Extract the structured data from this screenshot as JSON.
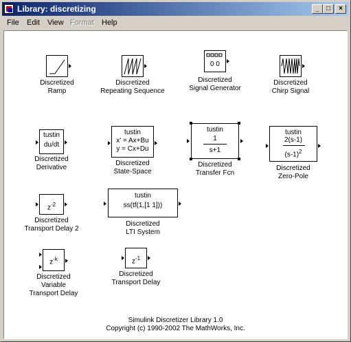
{
  "window": {
    "title": "Library: discretizing",
    "minimize": "_",
    "maximize": "□",
    "close": "×"
  },
  "menu": [
    "File",
    "Edit",
    "View",
    "Format",
    "Help"
  ],
  "blocks": {
    "ramp": {
      "label1": "Discretized",
      "label2": "Ramp"
    },
    "repeating": {
      "label1": "Discretized",
      "label2": "Repeating Sequence"
    },
    "signalgen": {
      "label1": "Discretized",
      "label2": "Signal Generator",
      "text": "0 0"
    },
    "chirp": {
      "label1": "Discretized",
      "label2": "Chirp Signal"
    },
    "derivative": {
      "label1": "Discretized",
      "label2": "Derivative",
      "method": "tustin",
      "text": "du/dt"
    },
    "statespace": {
      "label1": "Discretized",
      "label2": "State-Space",
      "method": "tustin",
      "eq1": "x' = Ax+Bu",
      "eq2": "y = Cx+Du"
    },
    "transferfcn": {
      "label1": "Discretized",
      "label2": "Transfer Fcn",
      "method": "tustin",
      "num": "1",
      "den": "s+1"
    },
    "zeropole": {
      "label1": "Discretized",
      "label2": "Zero-Pole",
      "method": "tustin",
      "num": "2(s-1)",
      "den": "(s-1)",
      "exp": "2"
    },
    "transportdelay2": {
      "label1": "Discretized",
      "label2": "Transport Delay 2",
      "base": "z",
      "exp": "-2"
    },
    "lti": {
      "label1": "Discretized",
      "label2": "LTI System",
      "method": "tustin",
      "text": "ss(tf(1,[1 1]))"
    },
    "vartransport": {
      "label1": "Discretized",
      "label2": "Variable",
      "label3": "Transport Delay",
      "base": "z",
      "exp": "-k"
    },
    "transportdelay": {
      "label1": "Discretized",
      "label2": "Transport Delay",
      "base": "z",
      "exp": "-1"
    }
  },
  "footer": {
    "line1": "Simulink Discretizer Library 1.0",
    "line2": "Copyright (c) 1990-2002 The MathWorks, Inc."
  }
}
